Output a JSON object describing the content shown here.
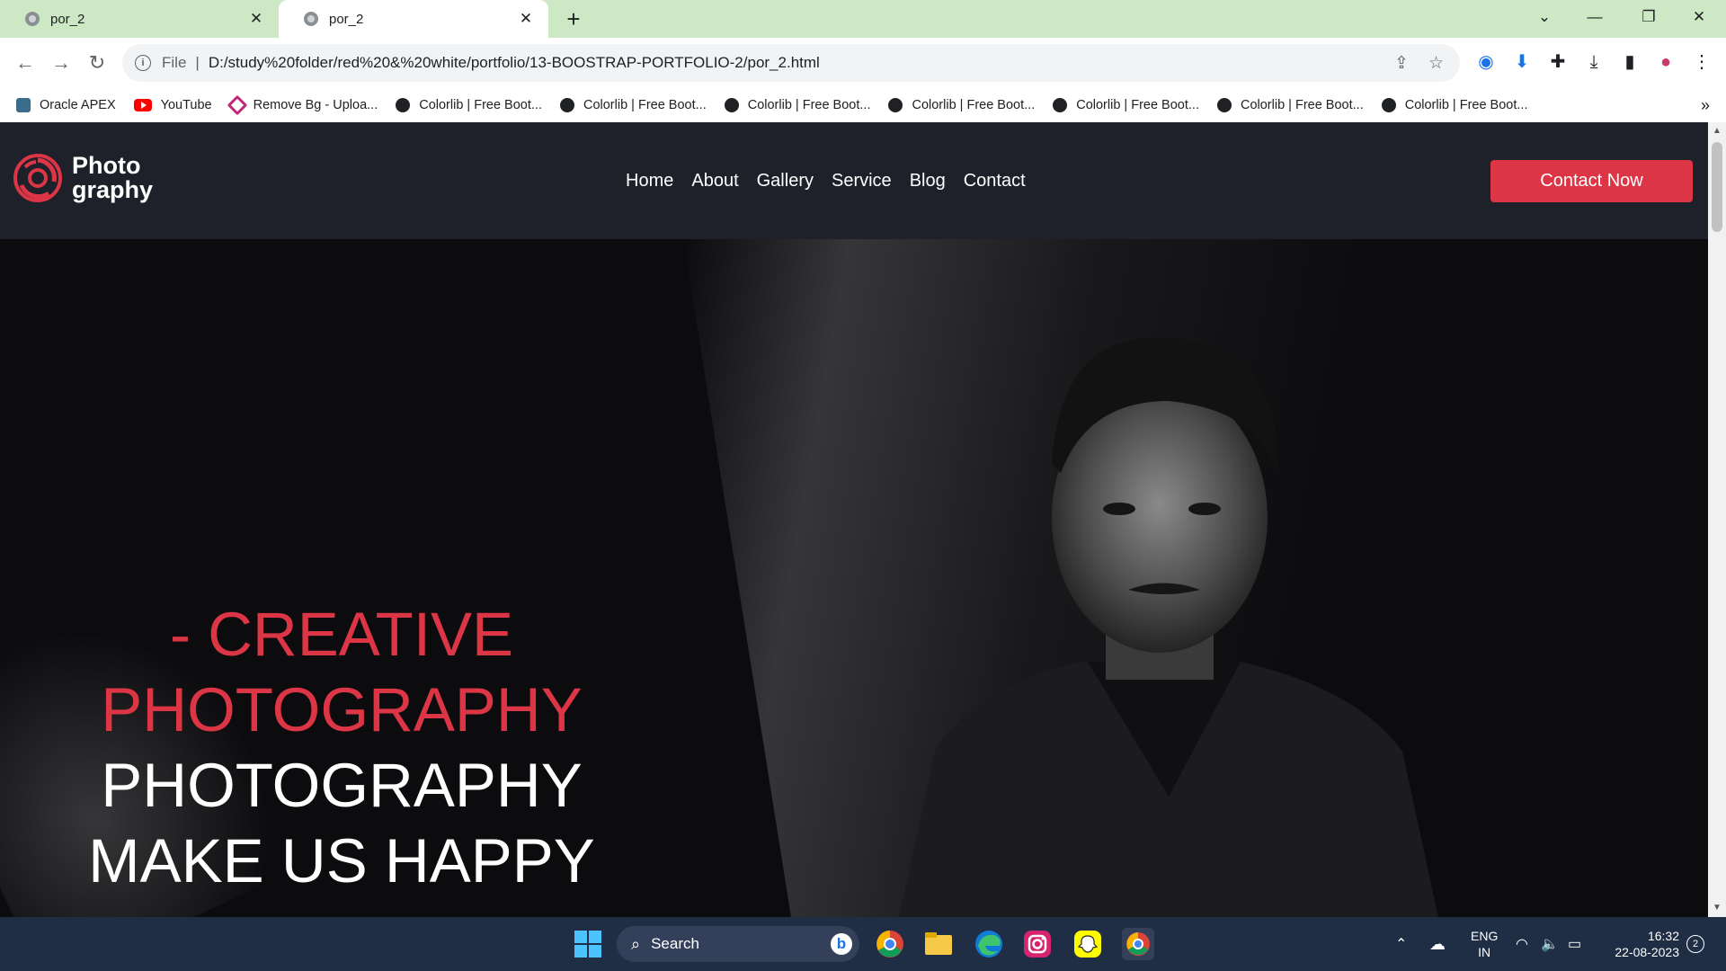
{
  "browser": {
    "tabs": [
      {
        "title": "por_2",
        "active": false
      },
      {
        "title": "por_2",
        "active": true
      }
    ],
    "new_tab": "+",
    "address": {
      "scheme": "File",
      "url": "D:/study%20folder/red%20&%20white/portfolio/13-BOOSTRAP-PORTFOLIO-2/por_2.html"
    },
    "bookmarks": [
      {
        "label": "Oracle APEX",
        "icon": "oracle-apex-icon"
      },
      {
        "label": "YouTube",
        "icon": "youtube-icon"
      },
      {
        "label": "Remove Bg - Uploa...",
        "icon": "remove-bg-icon"
      },
      {
        "label": "Colorlib | Free Boot...",
        "icon": "globe-icon"
      },
      {
        "label": "Colorlib | Free Boot...",
        "icon": "globe-icon"
      },
      {
        "label": "Colorlib | Free Boot...",
        "icon": "globe-icon"
      },
      {
        "label": "Colorlib | Free Boot...",
        "icon": "globe-icon"
      },
      {
        "label": "Colorlib | Free Boot...",
        "icon": "globe-icon"
      },
      {
        "label": "Colorlib | Free Boot...",
        "icon": "globe-icon"
      },
      {
        "label": "Colorlib | Free Boot...",
        "icon": "globe-icon"
      }
    ],
    "bookmarks_more": "»"
  },
  "site": {
    "logo": {
      "line1": "Photo",
      "line2": "graphy"
    },
    "nav": [
      "Home",
      "About",
      "Gallery",
      "Service",
      "Blog",
      "Contact"
    ],
    "cta": "Contact Now",
    "hero": {
      "accent_line1": "- CREATIVE",
      "accent_line2": "PHOTOGRAPHY",
      "line3": "PHOTOGRAPHY",
      "line4": "MAKE US HAPPY"
    },
    "colors": {
      "accent": "#dc3545",
      "header_bg": "#1e2129"
    }
  },
  "taskbar": {
    "search_placeholder": "Search",
    "language": {
      "line1": "ENG",
      "line2": "IN"
    },
    "time": "16:32",
    "date": "22-08-2023",
    "notification_count": "2"
  }
}
